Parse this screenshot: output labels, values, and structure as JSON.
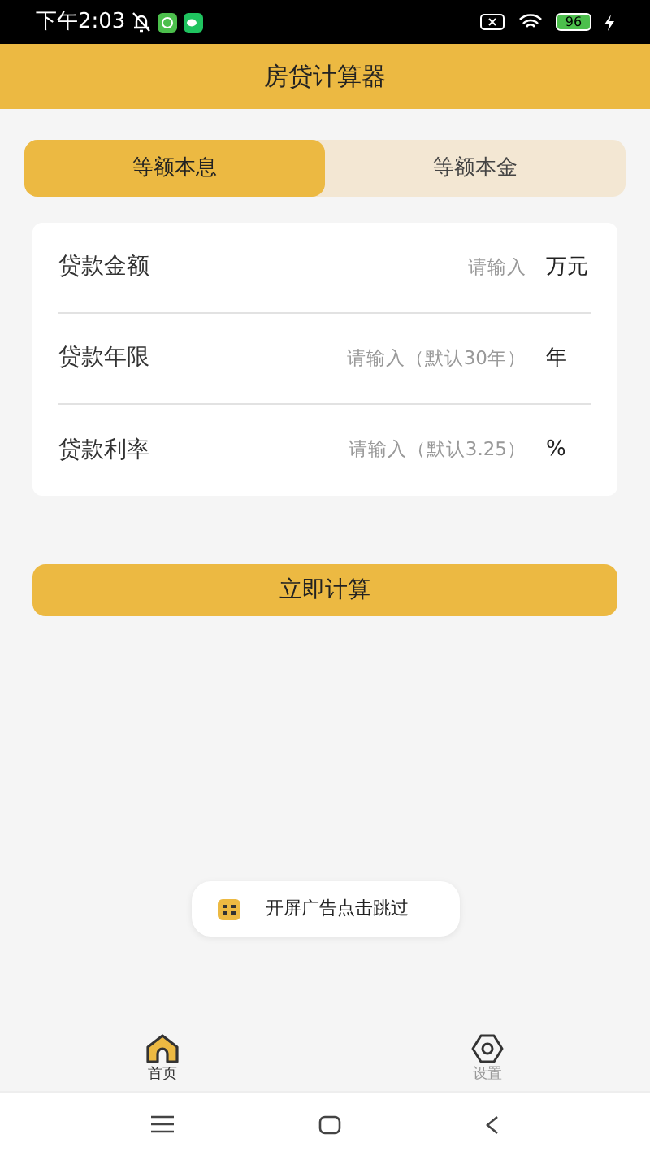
{
  "status_bar": {
    "time": "下午2:03",
    "battery": "96"
  },
  "header": {
    "title": "房贷计算器"
  },
  "tabs": [
    {
      "label": "等额本息",
      "selected": true
    },
    {
      "label": "等额本金",
      "selected": false
    }
  ],
  "fields": [
    {
      "label": "贷款金额",
      "placeholder": "请输入",
      "unit": "万元"
    },
    {
      "label": "贷款年限",
      "placeholder": "请输入（默认30年）",
      "unit": "年"
    },
    {
      "label": "贷款利率",
      "placeholder": "请输入（默认3.25）",
      "unit": "%"
    }
  ],
  "calculate_button": "立即计算",
  "toast": {
    "text": "开屏广告点击跳过"
  },
  "bottom_nav": [
    {
      "label": "首页",
      "kind": "home",
      "selected": true
    },
    {
      "label": "设置",
      "kind": "settings",
      "selected": false
    }
  ]
}
